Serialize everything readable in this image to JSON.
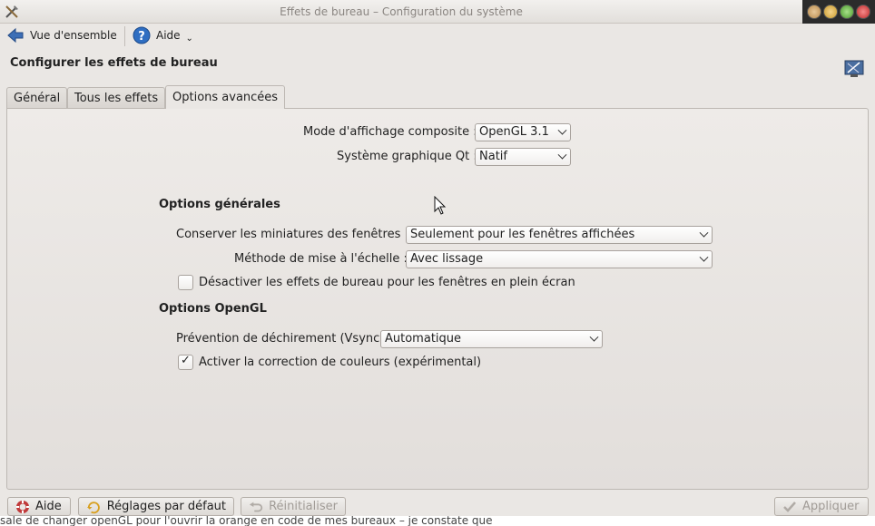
{
  "window": {
    "title": "Effets de bureau – Configuration du système",
    "controls": [
      "help-button",
      "minimize-button",
      "maximize-button",
      "close-button"
    ]
  },
  "toolbar": {
    "overview_label": "Vue d'ensemble",
    "help_label": "Aide"
  },
  "page": {
    "title": "Configurer les effets de bureau"
  },
  "tabs": [
    {
      "label": "Général",
      "active": false
    },
    {
      "label": "Tous les effets",
      "active": false
    },
    {
      "label": "Options avancées",
      "active": true
    }
  ],
  "compositing": {
    "mode_label": "Mode d'affichage composite :",
    "mode_value": "OpenGL 3.1",
    "qt_label": "Système graphique Qt :",
    "qt_value": "Natif"
  },
  "general_options": {
    "heading": "Options générales",
    "thumbnails_label": "Conserver les miniatures des fenêtres :",
    "thumbnails_value": "Seulement pour les fenêtres affichées",
    "scale_label": "Méthode de mise à l'échelle :",
    "scale_value": "Avec lissage",
    "disable_fullscreen_label": "Désactiver les effets de bureau pour les fenêtres en plein écran",
    "disable_fullscreen_checked": false
  },
  "opengl_options": {
    "heading": "Options OpenGL",
    "vsync_label": "Prévention de déchirement (Vsync)",
    "vsync_value": "Automatique",
    "color_correction_label": "Activer la correction de couleurs (expérimental)",
    "color_correction_checked": true
  },
  "footer": {
    "help_label": "Aide",
    "defaults_label": "Réglages par défaut",
    "reset_label": "Réinitialiser",
    "apply_label": "Appliquer"
  },
  "background_text": "sale de changer openGL pour l'ouvrir la orange en code de mes bureaux – je constate que"
}
